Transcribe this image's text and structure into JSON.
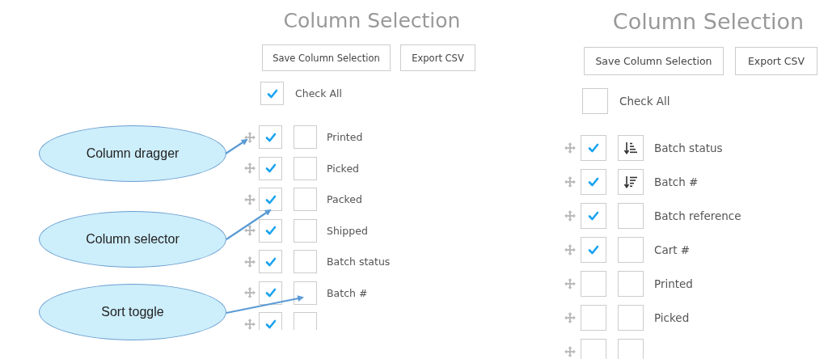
{
  "annotations": [
    {
      "text": "Column dragger"
    },
    {
      "text": "Column selector"
    },
    {
      "text": "Sort toggle"
    }
  ],
  "panels": [
    {
      "title": "Column Selection",
      "buttons": [
        "Save Column Selection",
        "Export CSV"
      ],
      "check_all": {
        "label": "Check All",
        "checked": true
      },
      "columns": [
        {
          "label": "Printed",
          "checked": true,
          "sorted": false
        },
        {
          "label": "Picked",
          "checked": true,
          "sorted": false
        },
        {
          "label": "Packed",
          "checked": true,
          "sorted": false
        },
        {
          "label": "Shipped",
          "checked": true,
          "sorted": false
        },
        {
          "label": "Batch status",
          "checked": true,
          "sorted": false
        },
        {
          "label": "Batch #",
          "checked": true,
          "sorted": false
        },
        {
          "checked": true,
          "sorted": false
        }
      ]
    },
    {
      "title": "Column Selection",
      "buttons": [
        "Save Column Selection",
        "Export CSV"
      ],
      "check_all": {
        "label": "Check All",
        "checked": false
      },
      "columns": [
        {
          "label": "Batch status",
          "checked": true,
          "sorted": true,
          "descending": false
        },
        {
          "label": "Batch #",
          "checked": true,
          "sorted": true,
          "descending": true
        },
        {
          "label": "Batch reference",
          "checked": true,
          "sorted": false
        },
        {
          "label": "Cart #",
          "checked": true,
          "sorted": false
        },
        {
          "label": "Printed",
          "checked": false,
          "sorted": false
        },
        {
          "label": "Picked",
          "checked": false,
          "sorted": false
        },
        {
          "checked": false,
          "sorted": false
        }
      ]
    }
  ]
}
